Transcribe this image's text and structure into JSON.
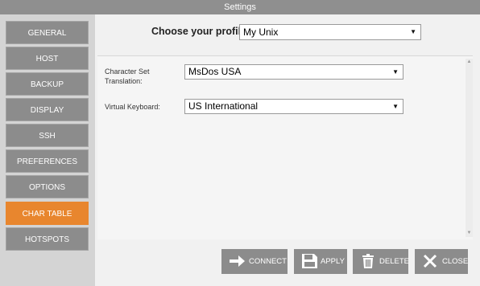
{
  "window": {
    "title": "Settings"
  },
  "sidebar": {
    "items": [
      {
        "label": "GENERAL"
      },
      {
        "label": "HOST"
      },
      {
        "label": "BACKUP"
      },
      {
        "label": "DISPLAY"
      },
      {
        "label": "SSH"
      },
      {
        "label": "PREFERENCES"
      },
      {
        "label": "OPTIONS"
      },
      {
        "label": "CHAR TABLE"
      },
      {
        "label": "HOTSPOTS"
      }
    ],
    "active": "CHAR TABLE",
    "accent_color": "#e8862e"
  },
  "profile": {
    "label": "Choose your profile:",
    "value": "My Unix"
  },
  "fields": {
    "charset": {
      "label": "Character Set Translation:",
      "value": "MsDos USA"
    },
    "keyboard": {
      "label": "Virtual Keyboard:",
      "value": "US International"
    }
  },
  "actions": {
    "connect": {
      "label": "CONNECT",
      "icon": "arrow-right-icon"
    },
    "apply": {
      "label": "APPLY",
      "icon": "floppy-disk-icon"
    },
    "delete": {
      "label": "DELETE",
      "icon": "trash-icon"
    },
    "close": {
      "label": "CLOSE",
      "icon": "close-x-icon"
    }
  }
}
